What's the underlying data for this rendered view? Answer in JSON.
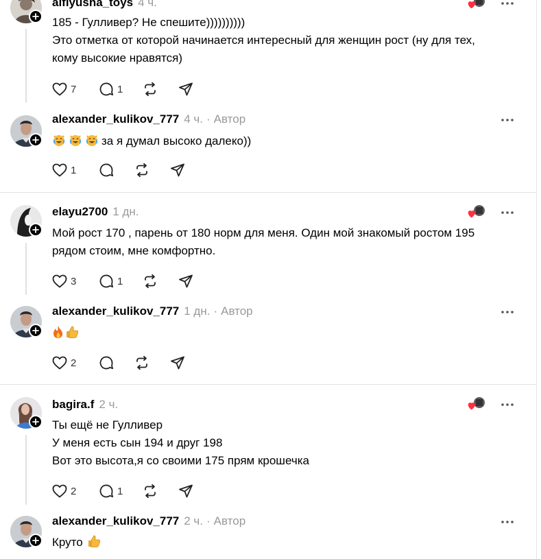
{
  "threads": [
    {
      "posts": [
        {
          "username": "alfiyusha_toys",
          "time": "4 ч.",
          "author_tag": "",
          "liked_by_author": true,
          "lines": [
            "185 - Гулливер? Не спешите))))))))))",
            "Это отметка от которой начинается интересный для женщин рост (ну для тех,",
            "кому высокие нравятся)"
          ],
          "likes": "7",
          "replies": "1"
        },
        {
          "username": "alexander_kulikov_777",
          "time": "4 ч.",
          "author_tag": "Автор",
          "liked_by_author": false,
          "lines": [
            "за я думал высоко далеко))"
          ],
          "emojis": [
            "crying-laughing-cat-emoji",
            "crying-laughing-cat-emoji",
            "crying-laughing-cat-emoji"
          ],
          "likes": "1",
          "replies": ""
        }
      ]
    },
    {
      "posts": [
        {
          "username": "elayu2700",
          "time": "1 дн.",
          "author_tag": "",
          "liked_by_author": true,
          "lines": [
            "Мой рост 170 , парень от 180 норм для меня. Один мой знакомый ростом 195",
            "рядом стоим, мне комфортно."
          ],
          "likes": "3",
          "replies": "1"
        },
        {
          "username": "alexander_kulikov_777",
          "time": "1 дн.",
          "author_tag": "Автор",
          "liked_by_author": false,
          "lines": [
            ""
          ],
          "emojis": [
            "fire-emoji",
            "thumbs-up-emoji"
          ],
          "likes": "2",
          "replies": ""
        }
      ]
    },
    {
      "posts": [
        {
          "username": "bagira.f",
          "time": "2 ч.",
          "author_tag": "",
          "liked_by_author": true,
          "lines": [
            "Ты ещё не Гулливер",
            "У меня есть сын 194 и друг 198",
            "Вот это высота,я со своими 175 прям крошечка"
          ],
          "likes": "2",
          "replies": "1"
        },
        {
          "username": "alexander_kulikov_777",
          "time": "2 ч.",
          "author_tag": "Автор",
          "liked_by_author": false,
          "lines": [
            "Круто"
          ],
          "emojis_after": [
            "thumbs-up-emoji"
          ],
          "likes": "",
          "replies": ""
        }
      ]
    }
  ],
  "dot_separator": "·",
  "colors": {
    "text": "#000000",
    "muted": "#999999",
    "divider": "#e3e3e3",
    "heart_red": "#ff3040"
  }
}
